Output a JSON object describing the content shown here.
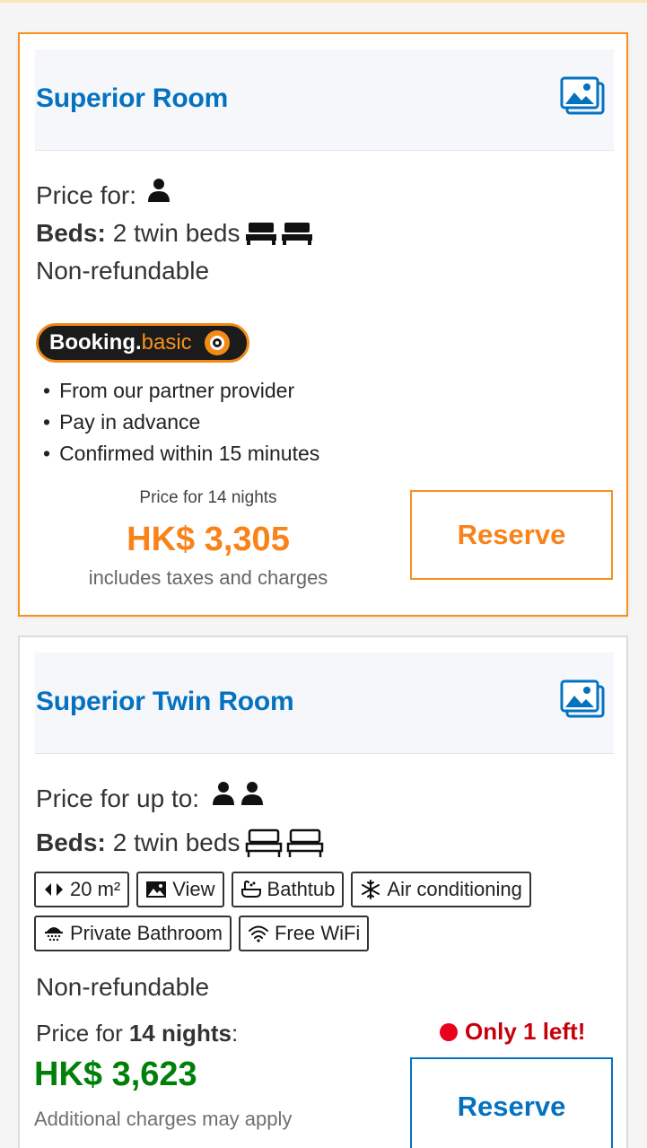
{
  "rooms": [
    {
      "title": "Superior Room",
      "price_for_label": "Price for:",
      "beds_label": "Beds:",
      "beds_value": "2 twin beds",
      "refund": "Non-refundable",
      "badge": {
        "brand": "Booking.",
        "tier": "basic"
      },
      "bullets": [
        "From our partner provider",
        "Pay in advance",
        "Confirmed within 15 minutes"
      ],
      "price_nights": "Price for 14 nights",
      "price": "HK$ 3,305",
      "price_note": "includes taxes and charges",
      "reserve_label": "Reserve",
      "accent": "#f8901e"
    },
    {
      "title": "Superior Twin Room",
      "price_for_label": "Price for up to:",
      "beds_label": "Beds:",
      "beds_value": "2 twin beds",
      "facilities": [
        {
          "icon": "room-size-icon",
          "label": "20 m²"
        },
        {
          "icon": "view-icon",
          "label": "View"
        },
        {
          "icon": "bathtub-icon",
          "label": "Bathtub"
        },
        {
          "icon": "snowflake-icon",
          "label": "Air conditioning"
        },
        {
          "icon": "shower-icon",
          "label": "Private Bathroom"
        },
        {
          "icon": "wifi-icon",
          "label": "Free WiFi"
        }
      ],
      "refund": "Non-refundable",
      "price_for_prefix": "Price for",
      "price_for_nights": "14 nights",
      "price_for_suffix": ":",
      "scarcity": "Only 1 left!",
      "price": "HK$ 3,623",
      "price_note": "Additional charges may apply",
      "reserve_label": "Reserve",
      "accent": "#0572c0"
    }
  ]
}
